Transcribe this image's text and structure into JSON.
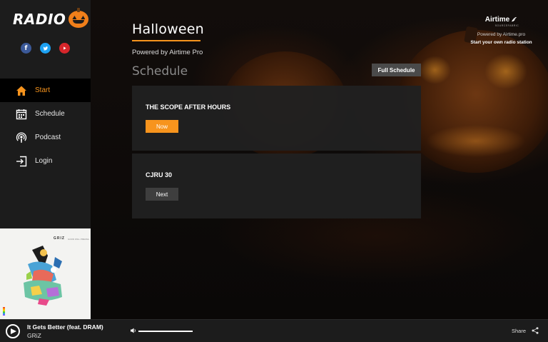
{
  "brand": {
    "logo_text": "RADIO",
    "logo_icon": "jack-o-lantern-icon"
  },
  "socials": [
    {
      "name": "facebook-icon",
      "glyph": "f",
      "color": "#3b5998"
    },
    {
      "name": "twitter-icon",
      "glyph": "t",
      "color": "#1da1f2"
    },
    {
      "name": "youtube-icon",
      "glyph": "▶",
      "color": "#d6262b"
    }
  ],
  "nav": {
    "items": [
      {
        "label": "Start",
        "icon": "home-icon",
        "active": true
      },
      {
        "label": "Schedule",
        "icon": "calendar-icon",
        "active": false
      },
      {
        "label": "Podcast",
        "icon": "podcast-icon",
        "active": false
      },
      {
        "label": "Login",
        "icon": "login-icon",
        "active": false
      }
    ]
  },
  "album": {
    "title": "GRIZ",
    "subtitle": "GOOD WILL PREVAIL"
  },
  "station": {
    "title": "Halloween",
    "powered": "Powered by Airtime Pro"
  },
  "schedule": {
    "heading": "Schedule",
    "full_button": "Full Schedule",
    "shows": [
      {
        "title": "THE SCOPE AFTER HOURS",
        "badge": "Now"
      },
      {
        "title": "CJRU 30",
        "badge": "Next"
      }
    ]
  },
  "airtime": {
    "logo": "Airtime",
    "sub": "SOURCEFABRIC",
    "powered": "Powered by Airtime.pro",
    "start": "Start your own radio station"
  },
  "player": {
    "track_title": "It Gets Better (feat. DRAM)",
    "artist": "GRiZ",
    "volume": 1.0,
    "share_label": "Share"
  },
  "colors": {
    "accent": "#f7941d",
    "sidebar": "#1c1c1c",
    "card": "#202020"
  }
}
